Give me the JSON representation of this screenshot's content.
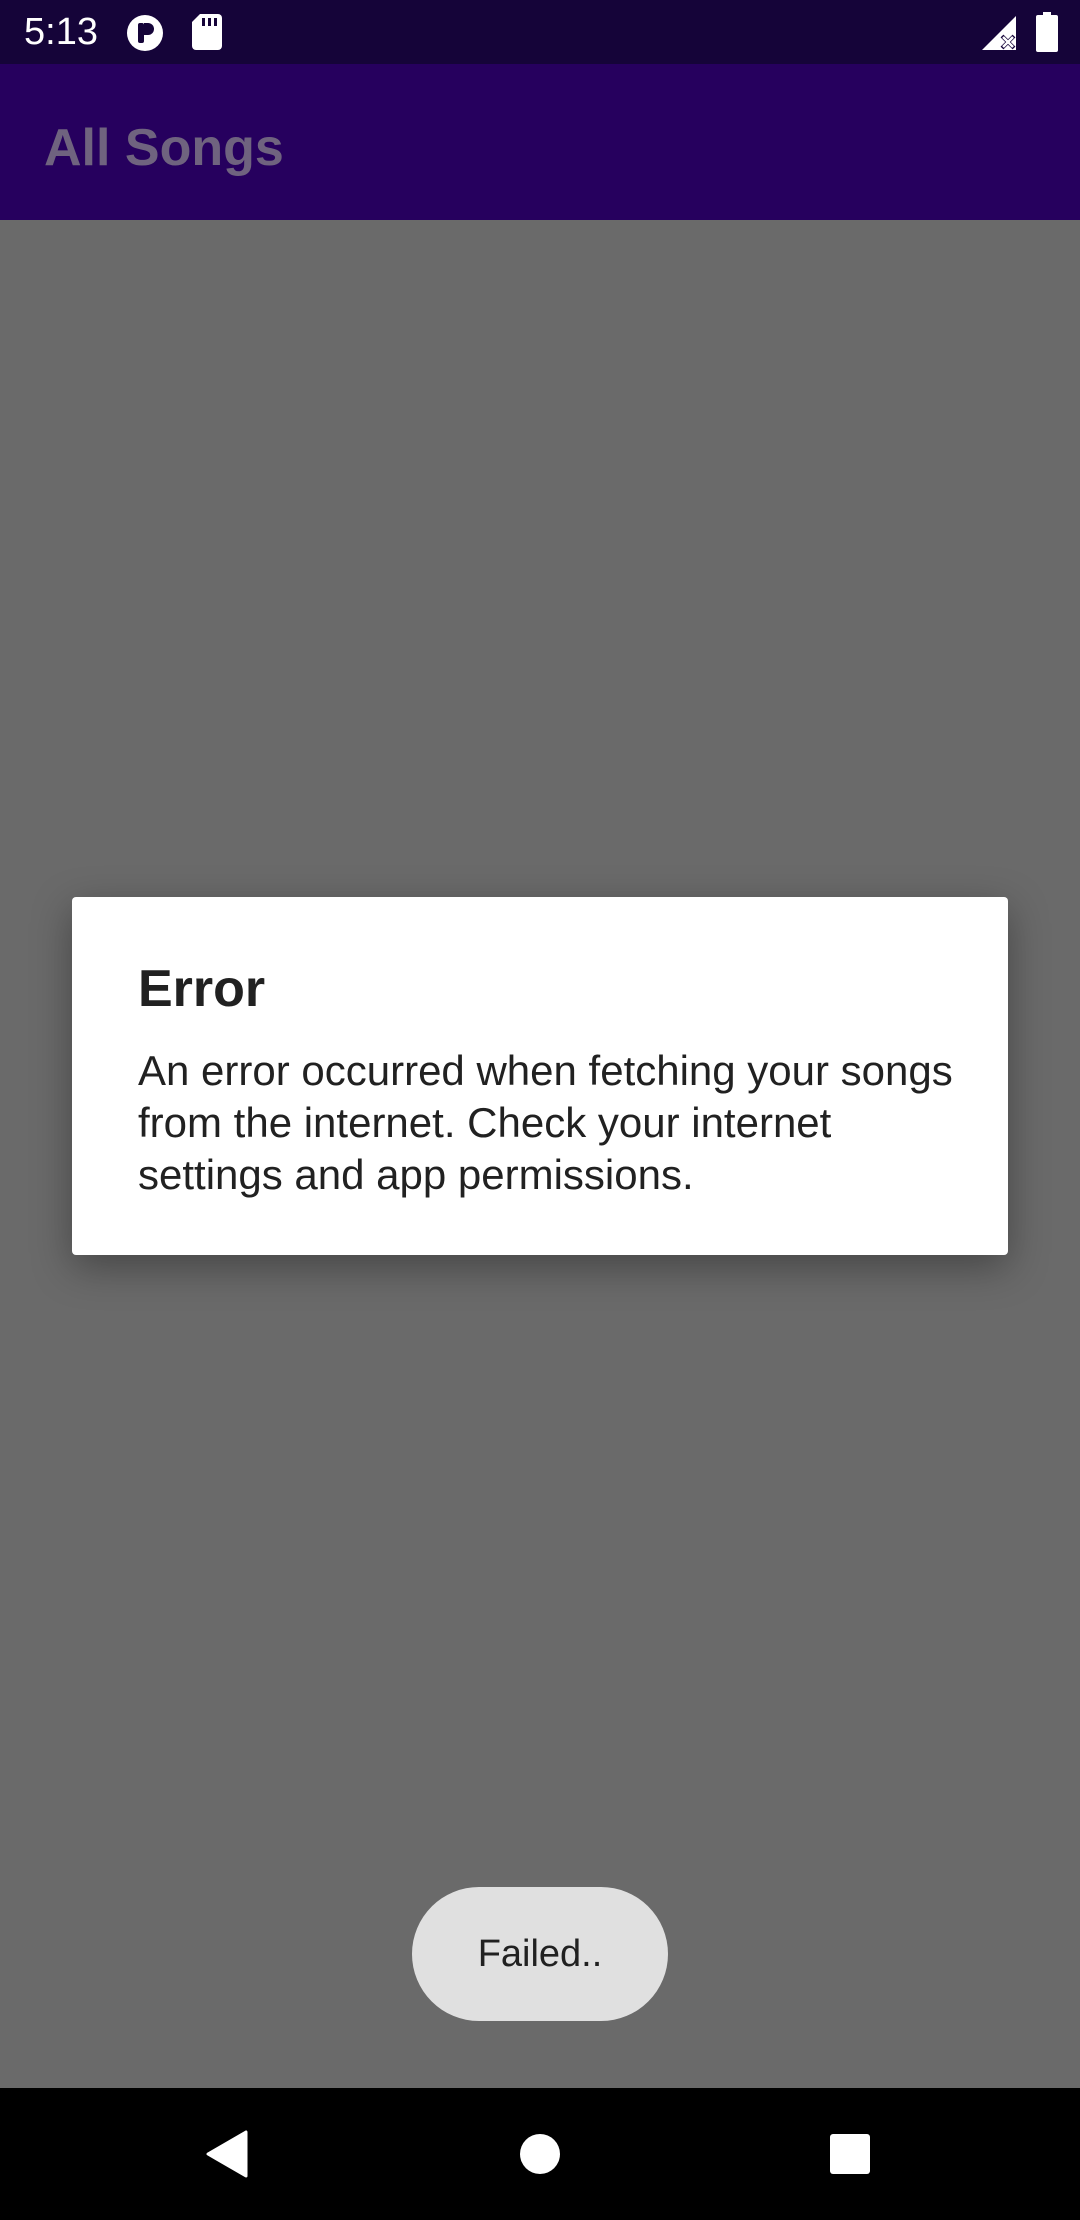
{
  "status_bar": {
    "time": "5:13",
    "icons": [
      "app-notification-icon",
      "sd-card-icon",
      "signal-no-data-icon",
      "battery-icon"
    ]
  },
  "app_bar": {
    "title": "All Songs"
  },
  "dialog": {
    "title": "Error",
    "message": "An error occurred when fetching your songs from the internet. Check your internet settings and app permissions."
  },
  "toast": {
    "text": "Failed.."
  },
  "nav_bar": {
    "buttons": [
      "back-icon",
      "home-icon",
      "recents-icon"
    ]
  },
  "colors": {
    "status_bar": "#150439",
    "app_bar": "#26005e",
    "scrim_background": "#6a6a6a",
    "dialog_background": "#ffffff",
    "toast_background": "#e0e0e0",
    "nav_bar": "#000000"
  }
}
